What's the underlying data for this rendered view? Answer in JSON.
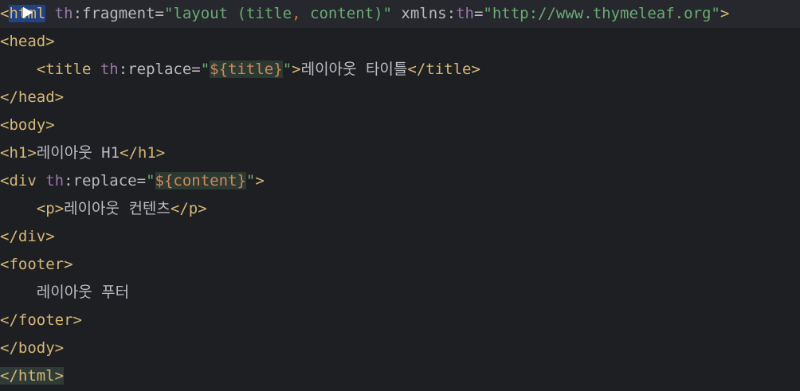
{
  "lines": {
    "l1": {
      "open": "<",
      "kw": "html",
      "attr1_ns": "th",
      "attr1_name": ":fragment",
      "attr1_eq": "=",
      "attr1_val_a": "\"layout (title",
      "attr1_comma": ",",
      "attr1_val_b": " content)\"",
      "attr2_name": "xmlns",
      "attr2_colon": ":",
      "attr2_ns": "th",
      "attr2_eq": "=",
      "attr2_val": "\"http://www.thymeleaf.org\"",
      "close": ">"
    },
    "l2": {
      "text": "<head>"
    },
    "l3": {
      "open": "<title",
      "ns": "th",
      "name": ":replace",
      "eq": "=",
      "q1": "\"",
      "expr": "${title}",
      "q2": "\"",
      "gt": ">",
      "content": "레이아웃 타이틀",
      "close": "</title>"
    },
    "l4": {
      "text": "</head>"
    },
    "l5": {
      "text": "<body>"
    },
    "l6": {
      "open": "<h1>",
      "content": "레이아웃 H1",
      "close": "</h1>"
    },
    "l7": {
      "open": "<div",
      "ns": "th",
      "name": ":replace",
      "eq": "=",
      "q1": "\"",
      "expr": "${content}",
      "q2": "\"",
      "gt": ">"
    },
    "l8": {
      "open": "<p>",
      "content": "레이아웃 컨텐츠",
      "close": "</p>"
    },
    "l9": {
      "text": "</div>"
    },
    "l10": {
      "text": "<footer>"
    },
    "l11": {
      "content": "레이아웃 푸터"
    },
    "l12": {
      "text": "</footer>"
    },
    "l13": {
      "text": "</body>"
    },
    "l14": {
      "text": "</html>"
    }
  }
}
